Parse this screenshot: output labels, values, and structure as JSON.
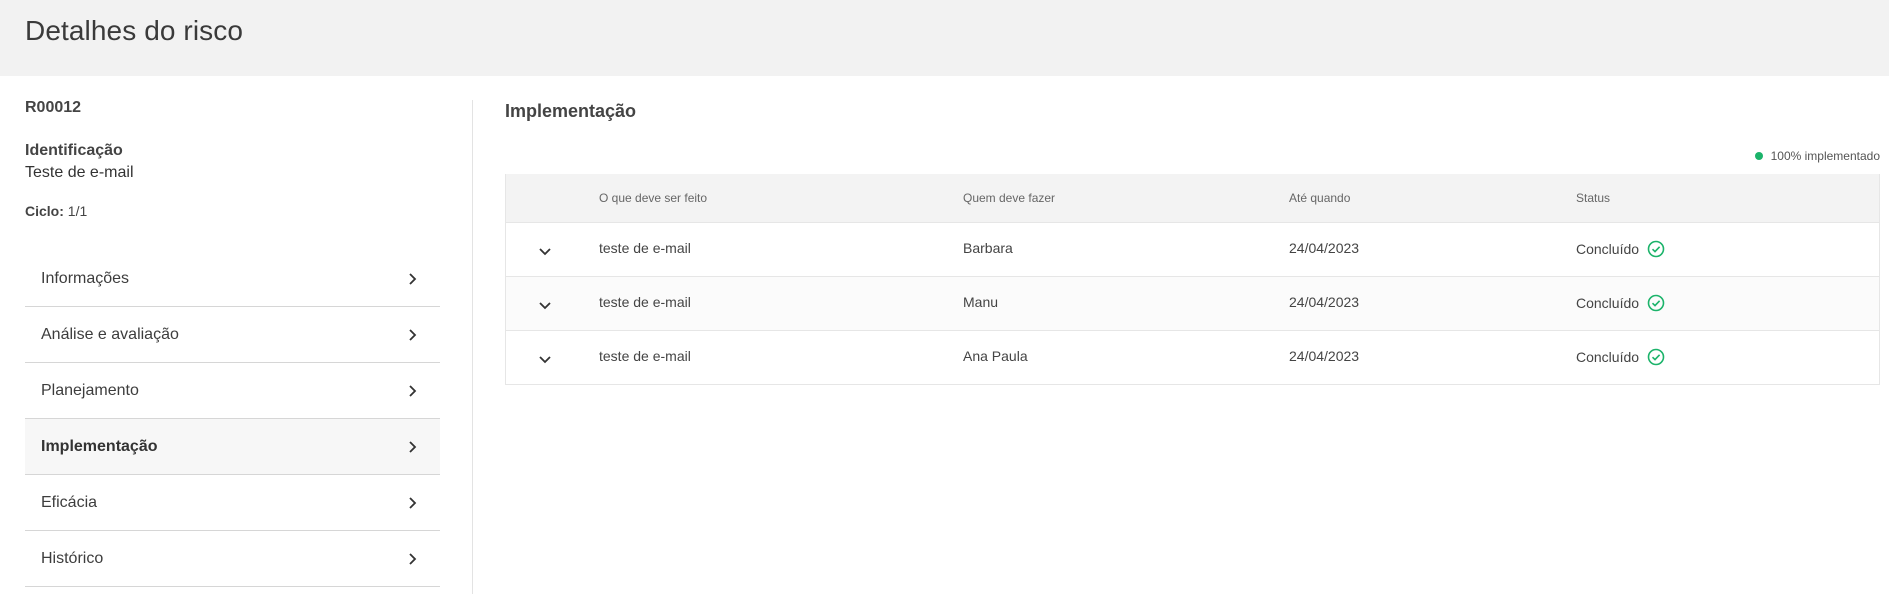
{
  "header": {
    "title": "Detalhes do risco"
  },
  "sidebar": {
    "risk_code": "R00012",
    "identification_label": "Identificação",
    "identification_value": "Teste de e-mail",
    "cycle_label": "Ciclo:",
    "cycle_value": "1/1",
    "items": [
      {
        "label": "Informações",
        "active": false
      },
      {
        "label": "Análise e avaliação",
        "active": false
      },
      {
        "label": "Planejamento",
        "active": false
      },
      {
        "label": "Implementação",
        "active": true
      },
      {
        "label": "Eficácia",
        "active": false
      },
      {
        "label": "Histórico",
        "active": false
      }
    ]
  },
  "main": {
    "section_title": "Implementação",
    "progress_label": "100% implementado",
    "progress_color": "#1bb36a",
    "table": {
      "headers": [
        "O que deve ser feito",
        "Quem deve fazer",
        "Até quando",
        "Status"
      ],
      "rows": [
        {
          "what": "teste de e-mail",
          "who": "Barbara",
          "when": "24/04/2023",
          "status": "Concluído"
        },
        {
          "what": "teste de e-mail",
          "who": "Manu",
          "when": "24/04/2023",
          "status": "Concluído"
        },
        {
          "what": "teste de e-mail",
          "who": "Ana Paula",
          "when": "24/04/2023",
          "status": "Concluído"
        }
      ]
    }
  },
  "icons": {
    "nav_chevron": "chevron-right-icon",
    "row_expander": "chevron-down-icon",
    "status_ok": "check-circle-icon"
  },
  "colors": {
    "header_bg": "#f2f2f2",
    "success": "#1bb36a"
  }
}
